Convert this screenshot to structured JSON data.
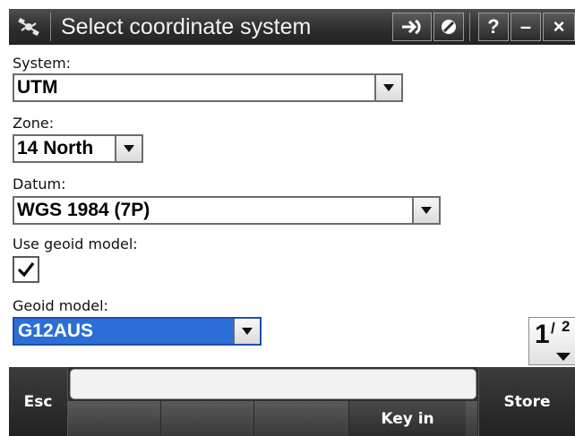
{
  "window": {
    "title": "Select coordinate system",
    "icons": {
      "app": "satellite-icon",
      "map": "map-arrow-icon",
      "stop": "no-entry-icon",
      "help": "?",
      "minimize": "–",
      "close": "×"
    }
  },
  "form": {
    "system": {
      "label": "System:",
      "value": "UTM"
    },
    "zone": {
      "label": "Zone:",
      "value": "14 North"
    },
    "datum": {
      "label": "Datum:",
      "value": "WGS 1984 (7P)"
    },
    "use_geoid": {
      "label": "Use geoid model:",
      "checked": true
    },
    "geoid_model": {
      "label": "Geoid model:",
      "value": "G12AUS"
    }
  },
  "pager": {
    "current": "1",
    "separator": "/",
    "total": "2"
  },
  "softkeys": {
    "esc": "Esc",
    "key_in": "Key in",
    "store": "Store"
  },
  "colors": {
    "titlebar": "#2e2e2e",
    "selection": "#2b6fd6",
    "softkey_bar": "#2f2f2f"
  }
}
